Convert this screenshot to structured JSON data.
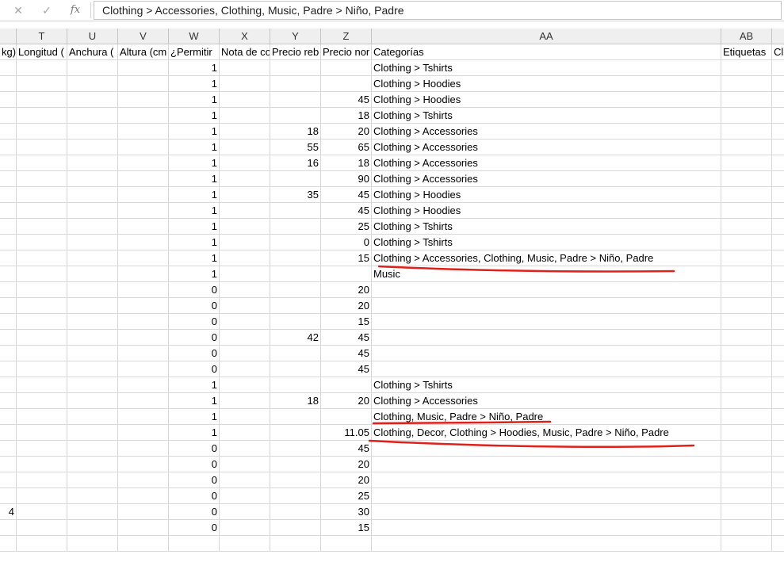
{
  "formula_bar": {
    "cancel_icon": "close-icon",
    "confirm_icon": "check-icon",
    "fx_label": "fx",
    "value": "Clothing > Accessories, Clothing, Music, Padre > Niño, Padre"
  },
  "columns": [
    {
      "key": "S",
      "letter": "",
      "header": "kg)"
    },
    {
      "key": "T",
      "letter": "T",
      "header": "Longitud ("
    },
    {
      "key": "U",
      "letter": "U",
      "header": "Anchura ("
    },
    {
      "key": "V",
      "letter": "V",
      "header": "Altura (cm"
    },
    {
      "key": "W",
      "letter": "W",
      "header": "¿Permitir"
    },
    {
      "key": "X",
      "letter": "X",
      "header": "Nota de co"
    },
    {
      "key": "Y",
      "letter": "Y",
      "header": "Precio reb"
    },
    {
      "key": "Z",
      "letter": "Z",
      "header": "Precio nor"
    },
    {
      "key": "AA",
      "letter": "AA",
      "header": "Categorías"
    },
    {
      "key": "AB",
      "letter": "AB",
      "header": "Etiquetas"
    },
    {
      "key": "AC",
      "letter": "",
      "header": "Cl"
    }
  ],
  "rows": [
    {
      "S": "",
      "W": "1",
      "Y": "",
      "Z": "",
      "AA": "Clothing > Tshirts"
    },
    {
      "S": "",
      "W": "1",
      "Y": "",
      "Z": "",
      "AA": "Clothing > Hoodies"
    },
    {
      "S": "",
      "W": "1",
      "Y": "",
      "Z": "45",
      "AA": "Clothing > Hoodies"
    },
    {
      "S": "",
      "W": "1",
      "Y": "",
      "Z": "18",
      "AA": "Clothing > Tshirts"
    },
    {
      "S": "",
      "W": "1",
      "Y": "18",
      "Z": "20",
      "AA": "Clothing > Accessories"
    },
    {
      "S": "",
      "W": "1",
      "Y": "55",
      "Z": "65",
      "AA": "Clothing > Accessories"
    },
    {
      "S": "",
      "W": "1",
      "Y": "16",
      "Z": "18",
      "AA": "Clothing > Accessories"
    },
    {
      "S": "",
      "W": "1",
      "Y": "",
      "Z": "90",
      "AA": "Clothing > Accessories"
    },
    {
      "S": "",
      "W": "1",
      "Y": "35",
      "Z": "45",
      "AA": "Clothing > Hoodies"
    },
    {
      "S": "",
      "W": "1",
      "Y": "",
      "Z": "45",
      "AA": "Clothing > Hoodies"
    },
    {
      "S": "",
      "W": "1",
      "Y": "",
      "Z": "25",
      "AA": "Clothing > Tshirts"
    },
    {
      "S": "",
      "W": "1",
      "Y": "",
      "Z": "0",
      "AA": "Clothing > Tshirts"
    },
    {
      "S": "",
      "W": "1",
      "Y": "",
      "Z": "15",
      "AA": "Clothing > Accessories, Clothing, Music, Padre > Niño, Padre"
    },
    {
      "S": "",
      "W": "1",
      "Y": "",
      "Z": "",
      "AA": "Music"
    },
    {
      "S": "",
      "W": "0",
      "Y": "",
      "Z": "20",
      "AA": ""
    },
    {
      "S": "",
      "W": "0",
      "Y": "",
      "Z": "20",
      "AA": ""
    },
    {
      "S": "",
      "W": "0",
      "Y": "",
      "Z": "15",
      "AA": ""
    },
    {
      "S": "",
      "W": "0",
      "Y": "42",
      "Z": "45",
      "AA": ""
    },
    {
      "S": "",
      "W": "0",
      "Y": "",
      "Z": "45",
      "AA": ""
    },
    {
      "S": "",
      "W": "0",
      "Y": "",
      "Z": "45",
      "AA": ""
    },
    {
      "S": "",
      "W": "1",
      "Y": "",
      "Z": "",
      "AA": "Clothing > Tshirts"
    },
    {
      "S": "",
      "W": "1",
      "Y": "18",
      "Z": "20",
      "AA": "Clothing > Accessories"
    },
    {
      "S": "",
      "W": "1",
      "Y": "",
      "Z": "",
      "AA": "Clothing, Music, Padre > Niño, Padre"
    },
    {
      "S": "",
      "W": "1",
      "Y": "",
      "Z": "11.05",
      "AA": "Clothing, Decor, Clothing > Hoodies, Music, Padre > Niño, Padre"
    },
    {
      "S": "",
      "W": "0",
      "Y": "",
      "Z": "45",
      "AA": ""
    },
    {
      "S": "",
      "W": "0",
      "Y": "",
      "Z": "20",
      "AA": ""
    },
    {
      "S": "",
      "W": "0",
      "Y": "",
      "Z": "20",
      "AA": ""
    },
    {
      "S": "",
      "W": "0",
      "Y": "",
      "Z": "25",
      "AA": ""
    },
    {
      "S": "4",
      "W": "0",
      "Y": "",
      "Z": "30",
      "AA": ""
    },
    {
      "S": "",
      "W": "0",
      "Y": "",
      "Z": "15",
      "AA": ""
    },
    {
      "S": "",
      "W": "",
      "Y": "",
      "Z": "",
      "AA": ""
    }
  ],
  "annotation_color": "#e0201b"
}
